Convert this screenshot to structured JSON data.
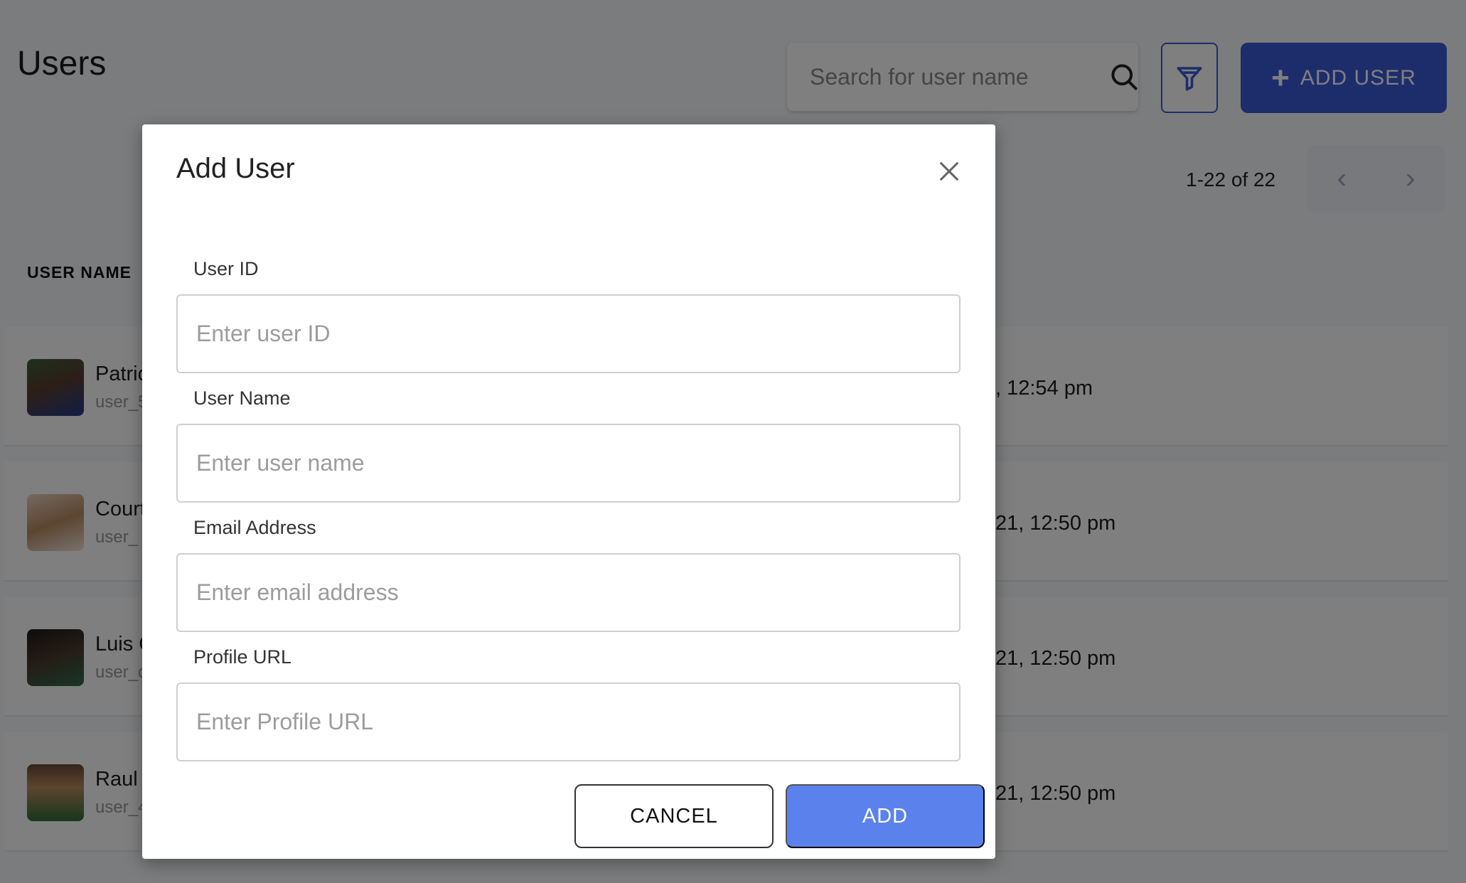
{
  "page": {
    "title": "Users",
    "search": {
      "placeholder": "Search for user name"
    },
    "add_user_label": "ADD USER",
    "pagination": {
      "text": "1-22 of 22",
      "prev": "‹",
      "next": "›"
    },
    "columns": {
      "user_name": "USER NAME"
    },
    "rows": [
      {
        "name": "Patric",
        "sub": "user_5",
        "date": ", 12:54 pm"
      },
      {
        "name": "Court",
        "sub": "user_",
        "date": "21, 12:50 pm"
      },
      {
        "name": "Luis C",
        "sub": "user_c",
        "date": "21, 12:50 pm"
      },
      {
        "name": "Raul",
        "sub": "user_4",
        "date": "21, 12:50 pm"
      }
    ]
  },
  "modal": {
    "title": "Add User",
    "fields": [
      {
        "label": "User ID",
        "placeholder": "Enter user ID",
        "value": ""
      },
      {
        "label": "User Name",
        "placeholder": "Enter user name",
        "value": ""
      },
      {
        "label": "Email Address",
        "placeholder": "Enter email address",
        "value": ""
      },
      {
        "label": "Profile URL",
        "placeholder": "Enter Profile URL",
        "value": ""
      }
    ],
    "cancel_label": "CANCEL",
    "add_label": "ADD"
  },
  "colors": {
    "primary": "#3a5bd9",
    "add_button": "#5b82ec",
    "overlay": "rgba(0,0,0,0.5)"
  },
  "icons": {
    "search": "search-icon",
    "filter": "filter-icon",
    "plus": "plus-icon",
    "close": "close-icon",
    "prev": "chevron-left-icon",
    "next": "chevron-right-icon"
  }
}
